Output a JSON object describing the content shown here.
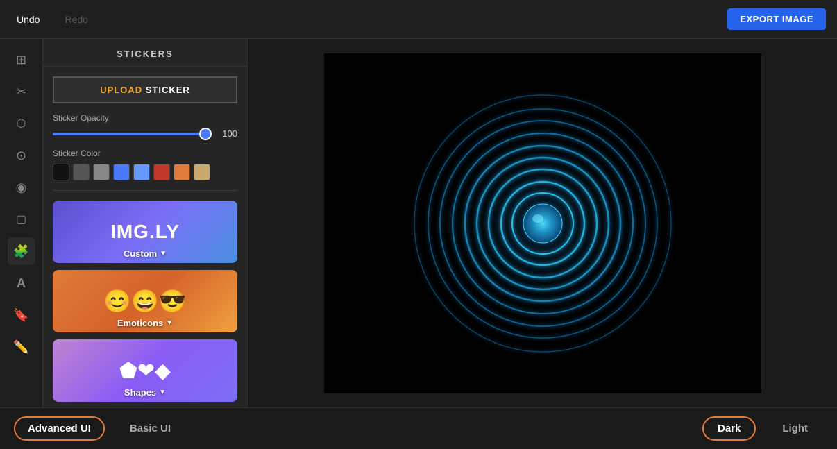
{
  "topbar": {
    "undo_label": "Undo",
    "redo_label": "Redo",
    "export_label": "EXPORT IMAGE"
  },
  "sidebar": {
    "title": "STICKERS",
    "upload_label_before": "UPLOAD",
    "upload_label_after": "STICKER",
    "opacity_label": "Sticker Opacity",
    "opacity_value": "100",
    "color_label": "Sticker Color",
    "colors": [
      {
        "hex": "#111111"
      },
      {
        "hex": "#555555"
      },
      {
        "hex": "#888888"
      },
      {
        "hex": "#4a7aff"
      },
      {
        "hex": "#6699ff"
      },
      {
        "hex": "#c0392b"
      },
      {
        "hex": "#e07b39"
      },
      {
        "hex": "#c8a96e"
      }
    ],
    "sticker_packs": [
      {
        "id": "custom",
        "label": "Custom"
      },
      {
        "id": "emoticons",
        "label": "Emoticons"
      },
      {
        "id": "shapes",
        "label": "Shapes"
      }
    ]
  },
  "iconbar": {
    "icons": [
      {
        "name": "layout-icon",
        "glyph": "▦"
      },
      {
        "name": "crop-icon",
        "glyph": "⊞"
      },
      {
        "name": "filter-icon",
        "glyph": "◉"
      },
      {
        "name": "adjustment-icon",
        "glyph": "⊙"
      },
      {
        "name": "focus-icon",
        "glyph": "◎"
      },
      {
        "name": "frame-icon",
        "glyph": "▢"
      },
      {
        "name": "sticker-icon",
        "glyph": "✦",
        "active": true
      },
      {
        "name": "text-icon",
        "glyph": "A"
      },
      {
        "name": "overlay-icon",
        "glyph": "⊟"
      },
      {
        "name": "brush-icon",
        "glyph": "✏"
      }
    ]
  },
  "bottombar": {
    "advanced_ui_label": "Advanced UI",
    "basic_ui_label": "Basic UI",
    "dark_label": "Dark",
    "light_label": "Light"
  }
}
